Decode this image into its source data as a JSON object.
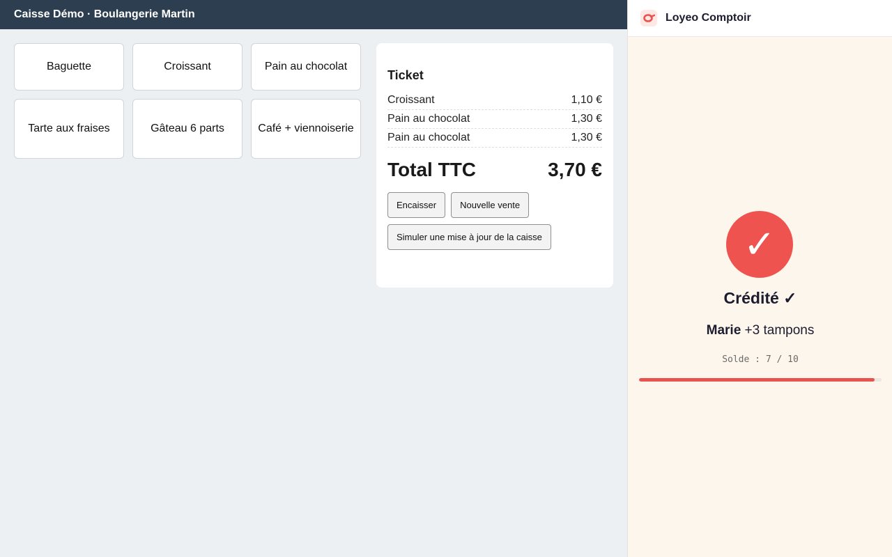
{
  "pos": {
    "title": "Caisse Démo · Boulangerie Martin",
    "products": [
      "Baguette",
      "Croissant",
      "Pain au chocolat",
      "Tarte aux fraises",
      "Gâteau 6 parts",
      "Café + viennoiserie"
    ]
  },
  "ticket": {
    "heading": "Ticket",
    "lines": [
      {
        "name": "Croissant",
        "price": "1,10 €"
      },
      {
        "name": "Pain au chocolat",
        "price": "1,30 €"
      },
      {
        "name": "Pain au chocolat",
        "price": "1,30 €"
      }
    ],
    "total_label": "Total TTC",
    "total_value": "3,70 €",
    "buttons": {
      "checkout": "Encaisser",
      "new_sale": "Nouvelle vente",
      "simulate": "Simuler une mise à jour de la caisse"
    }
  },
  "loyalty": {
    "brand": "Loyeo Comptoir",
    "status": "Crédité ✓",
    "check_glyph": "✓",
    "customer": "Marie",
    "stamps_text": "+3 tampons",
    "balance_text": "Solde : 7 / 10",
    "progress": 0.97,
    "accent": "#ef5350"
  }
}
